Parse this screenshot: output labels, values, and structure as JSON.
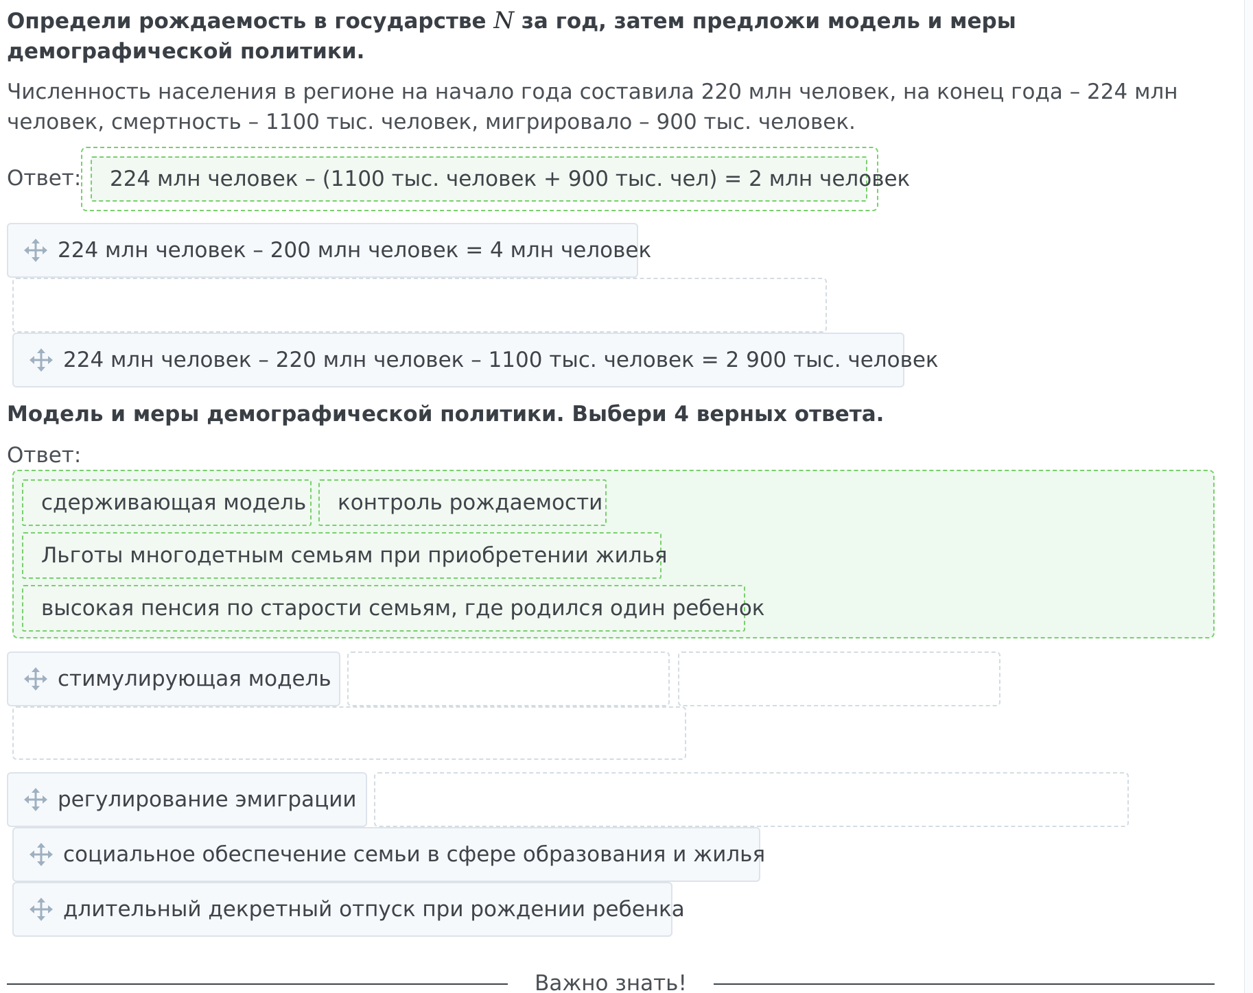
{
  "task": {
    "title_before": "Определи рождаемость в государстве ",
    "title_var": "N",
    "title_after": " за год, затем предложи модель и меры демографической политики.",
    "description": "Численность населения в регионе на начало года составила 220 млн человек, на конец года – 224 млн человек, смертность – 1100 тыс. человек, мигрировало – 900 тыс. человек."
  },
  "part1": {
    "answer_label": "Ответ:",
    "selected_answer": "224 млн человек – (1100 тыс. человек + 900 тыс. чел) = 2 млн человек",
    "options": [
      "224 млн человек – 200 млн человек = 4 млн человек",
      "224 млн человек – 220 млн человек – 1100 тыс. человек = 2 900 тыс. человек"
    ]
  },
  "part2": {
    "title": "Модель и меры демографической политики. Выбери 4 верных ответа.",
    "answer_label": "Ответ:",
    "selected_answers": [
      "сдерживающая модель",
      "контроль рождаемости",
      "Льготы многодетным семьям при приобретении жилья",
      "высокая пенсия по старости семьям, где родился один ребенок"
    ],
    "options": [
      "стимулирующая модель",
      "регулирование эмиграции",
      "социальное обеспечение семьи в сфере образования и жилья",
      "длительный декретный отпуск при рождении ребенка"
    ]
  },
  "footer": {
    "label": "Важно знать!"
  },
  "icons": {
    "drag_handle": "move-arrows-icon"
  },
  "colors": {
    "correct_border": "#79cf6c",
    "correct_fill": "#eef9f0",
    "option_fill": "#f6f9fc",
    "handle": "#9fb0c0"
  }
}
